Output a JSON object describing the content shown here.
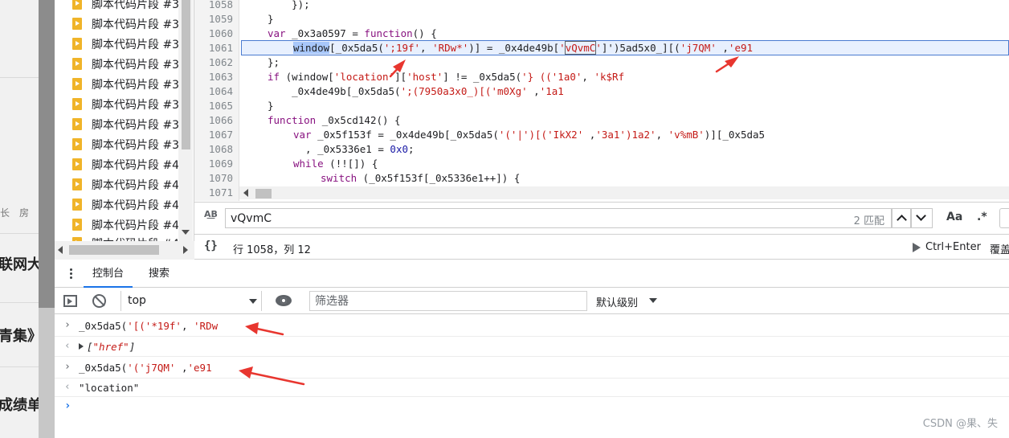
{
  "background_page": {
    "fragments": [
      "长　房",
      "联网大",
      "青集》",
      "成绩单"
    ]
  },
  "file_tree": {
    "items": [
      "脚本代码片段 #3",
      "脚本代码片段 #3",
      "脚本代码片段 #3",
      "脚本代码片段 #3",
      "脚本代码片段 #3",
      "脚本代码片段 #3",
      "脚本代码片段 #3",
      "脚本代码片段 #3",
      "脚本代码片段 #4",
      "脚本代码片段 #4",
      "脚本代码片段 #4",
      "脚本代码片段 #4",
      "脚本代码片段 #4"
    ]
  },
  "editor": {
    "line_numbers": [
      "1058",
      "1059",
      "1060",
      "1061",
      "1062",
      "1063",
      "1064",
      "1065",
      "1066",
      "1067",
      "1068",
      "1069",
      "1070",
      "1071"
    ],
    "lines": {
      "l1058": "    });",
      "l1059": "}",
      "l1060_var": "var",
      "l1060_rest": " _0x3a0597 = ",
      "l1060_fn": "function",
      "l1060_end": "() {",
      "l1061_win": "window",
      "l1061_a": "[_0x5da5(",
      "l1061_s1": "';19f'",
      "l1061_b": ", ",
      "l1061_s2": "'RDw*'",
      "l1061_c": ")] = _0x4de49b[",
      "l1061_s3q": "'",
      "l1061_s3": "vQvmC",
      "l1061_s3e": "'",
      "l1061_d": "]')5ad5x0_][(",
      "l1061_s4": "'j7QM'",
      "l1061_e": " ,",
      "l1061_s5": "'e91",
      "l1062": "};",
      "l1063_if": "if",
      "l1063_a": " (window[",
      "l1063_s1": "'location'",
      "l1063_b": "][",
      "l1063_s2": "'host'",
      "l1063_c": "] != _0x5da5(",
      "l1063_d": "'} ((",
      "l1063_s3": "'1a0'",
      "l1063_e": ", ",
      "l1063_s4": "'k$Rf",
      "l1064_a": "    _0x4de49b[_0x5da5(",
      "l1064_b": "';(7950a3x0_)[(",
      "l1064_s1": "'m0Xg'",
      "l1064_c": " ,",
      "l1064_s2": "'1a1",
      "l1065": "}",
      "l1066_fn": "function",
      "l1066_rest": " _0x5cd142() {",
      "l1067_var": "var",
      "l1067_a": " _0x5f153f = _0x4de49b[_0x5da5(",
      "l1067_s1": "'('|')[('",
      "l1067_s2": "IkX2'",
      "l1067_b": " ,",
      "l1067_s3": "'3a1')1a2'",
      "l1067_c": ", ",
      "l1067_s4": "'v%mB'",
      "l1067_d": ")][_0x5da5",
      "l1068_a": "  , _0x5336e1 = ",
      "l1068_num": "0x0",
      "l1068_b": ";",
      "l1069_kw": "while",
      "l1069_rest": " (!![]) {",
      "l1070_kw": "switch",
      "l1070_rest": " (_0x5f153f[_0x5336e1++]) {"
    }
  },
  "search_bar": {
    "query": "vQvmC",
    "match_count": "2 匹配",
    "match_case_label": "Aa",
    "regex_label": ".*",
    "regex_case_icon": "A͟B"
  },
  "status_bar": {
    "cursor_position": "行 1058，列 12",
    "pretty_print": "{}",
    "run_label": "Ctrl+Enter",
    "coverage_label": "覆盖"
  },
  "drawer_tabs": {
    "console": "控制台",
    "search": "搜索"
  },
  "console_toolbar": {
    "context": "top",
    "filter_placeholder": "筛选器",
    "level": "默认级别"
  },
  "console": {
    "entries": [
      {
        "input_a": "_0x5da5(",
        "input_b": "'[(",
        "input_s1": "'*19f'",
        "input_c": ", ",
        "input_s2": "'RDw",
        "result_open": "[",
        "result_str": "\"href\"",
        "result_close": "]"
      },
      {
        "input_a": "_0x5da5(",
        "input_b": "'(",
        "input_s1": "'j7QM'",
        "input_c": " ,",
        "input_s2": "'e91",
        "result_str": "\"location\""
      }
    ]
  },
  "watermark": "CSDN @果、失",
  "colors": {
    "keyword": "#881280",
    "string": "#c41a16",
    "accent": "#1a73e8",
    "annotation_arrow": "#e8362f"
  }
}
